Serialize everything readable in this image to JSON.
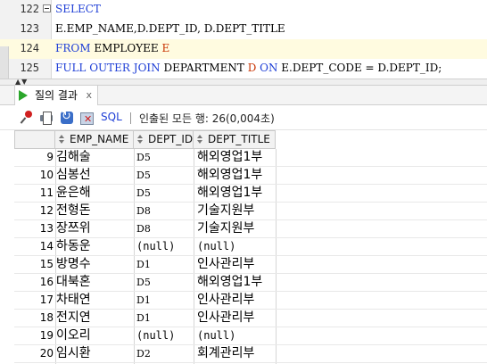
{
  "editor": {
    "lines": [
      {
        "num": "122",
        "tokens": [
          [
            "kw",
            "SELECT"
          ]
        ]
      },
      {
        "num": "123",
        "tokens": [
          [
            "id",
            "E.EMP_NAME,D.DEPT_ID, D.DEPT_TITLE"
          ]
        ]
      },
      {
        "num": "124",
        "tokens": [
          [
            "kw",
            "FROM "
          ],
          [
            "id",
            "EMPLOYEE "
          ],
          [
            "alias",
            "E"
          ]
        ]
      },
      {
        "num": "125",
        "tokens": [
          [
            "kw",
            "FULL OUTER JOIN "
          ],
          [
            "id",
            "DEPARTMENT "
          ],
          [
            "alias",
            "D"
          ],
          [
            "kw",
            " ON "
          ],
          [
            "id",
            "E.DEPT_CODE = D.DEPT_ID;"
          ]
        ]
      }
    ]
  },
  "results_tab": {
    "label": "질의 결과",
    "close": "x"
  },
  "toolbar": {
    "sql_label": "SQL",
    "status": "인출된 모든 행: 26(0,004초)"
  },
  "grid": {
    "columns": [
      "EMP_NAME",
      "DEPT_ID",
      "DEPT_TITLE"
    ],
    "rows": [
      {
        "num": "9",
        "name": "김해술",
        "dept_id": "D5",
        "title": "해외영업1부"
      },
      {
        "num": "10",
        "name": "심봉선",
        "dept_id": "D5",
        "title": "해외영업1부"
      },
      {
        "num": "11",
        "name": "윤은해",
        "dept_id": "D5",
        "title": "해외영업1부"
      },
      {
        "num": "12",
        "name": "전형돈",
        "dept_id": "D8",
        "title": "기술지원부"
      },
      {
        "num": "13",
        "name": "장쯔위",
        "dept_id": "D8",
        "title": "기술지원부"
      },
      {
        "num": "14",
        "name": "하동운",
        "dept_id": "(null)",
        "title": "(null)"
      },
      {
        "num": "15",
        "name": "방명수",
        "dept_id": "D1",
        "title": "인사관리부"
      },
      {
        "num": "16",
        "name": "대북혼",
        "dept_id": "D5",
        "title": "해외영업1부"
      },
      {
        "num": "17",
        "name": "차태연",
        "dept_id": "D1",
        "title": "인사관리부"
      },
      {
        "num": "18",
        "name": "전지연",
        "dept_id": "D1",
        "title": "인사관리부"
      },
      {
        "num": "19",
        "name": "이오리",
        "dept_id": "(null)",
        "title": "(null)"
      },
      {
        "num": "20",
        "name": "임시환",
        "dept_id": "D2",
        "title": "회계관리부"
      }
    ]
  }
}
